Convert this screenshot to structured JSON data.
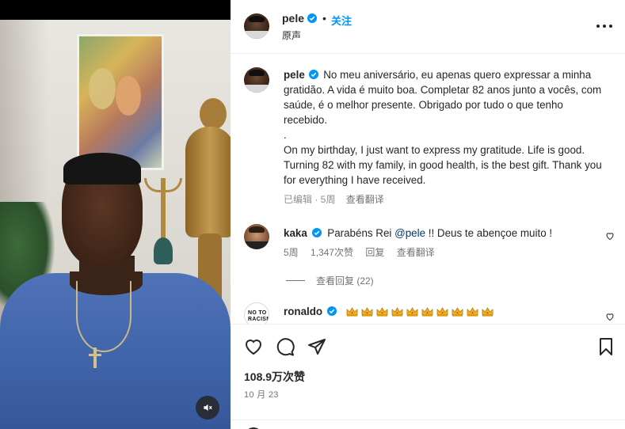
{
  "header": {
    "username": "pele",
    "separator": "•",
    "follow_label": "关注",
    "subtitle": "原声"
  },
  "caption": {
    "username": "pele",
    "text": "No meu aniversário, eu apenas quero expressar a minha gratidão. A vida é muito boa. Completar 82 anos junto a vocês, com saúde, é o melhor presente. Obrigado por tudo o que tenho recebido.\n.\nOn my birthday, I just want to express my gratitude. Life is good. Turning 82 with my family, in good health, is the best gift. Thank you for everything I have received.",
    "edited_time": "已编辑 · 5周",
    "see_translation": "查看翻译"
  },
  "comments": [
    {
      "username": "kaka",
      "text_before": "Parabéns Rei ",
      "mention": "@pele",
      "text_after": " !! Deus te abençoe muito !",
      "time": "5周",
      "likes": "1,347次赞",
      "reply": "回复",
      "see_translation": "查看翻译",
      "view_replies": "查看回复 (22)"
    },
    {
      "username": "ronaldo",
      "avatar_text": "NO TO RACISM",
      "emoji": [
        "crown-icon",
        "crown-icon",
        "crown-icon",
        "crown-icon",
        "crown-icon",
        "crown-icon",
        "crown-icon",
        "crown-icon",
        "crown-icon",
        "crown-icon"
      ]
    }
  ],
  "actions": {
    "likes": "108.9万次赞",
    "date": "10 月 23"
  },
  "icons": {
    "verified": "verified-badge-icon",
    "more": "more-horizontal-icon",
    "like": "heart-icon",
    "comment": "comment-bubble-icon",
    "share": "paper-plane-icon",
    "save": "bookmark-icon",
    "mute": "speaker-muted-icon"
  },
  "colors": {
    "accent": "#0095f6",
    "verified": "#0095f6",
    "text": "#262626",
    "muted": "#737373",
    "shirt": "#3f63a8"
  }
}
